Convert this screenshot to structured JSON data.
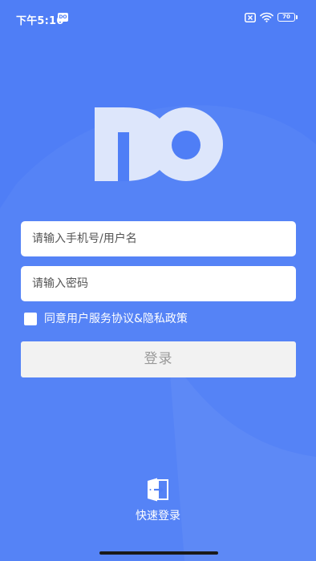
{
  "status_bar": {
    "time": "下午5:16",
    "app_badge": "DO",
    "battery_level": "70",
    "icons": [
      "app-badge-icon",
      "sim-disabled-icon",
      "wifi-icon",
      "battery-icon"
    ]
  },
  "logo": {
    "name": "do-logo"
  },
  "form": {
    "username_placeholder": "请输入手机号/用户名",
    "password_placeholder": "请输入密码",
    "agreement_text": "同意用户服务协议&隐私政策",
    "agreement_checked": false,
    "login_label": "登录"
  },
  "quick_login": {
    "label": "快速登录",
    "icon": "door-enter-icon"
  },
  "colors": {
    "background": "#4f7ef6",
    "logo": "#dde6fb",
    "button_bg": "#f2f2f2",
    "button_text": "#999999"
  }
}
